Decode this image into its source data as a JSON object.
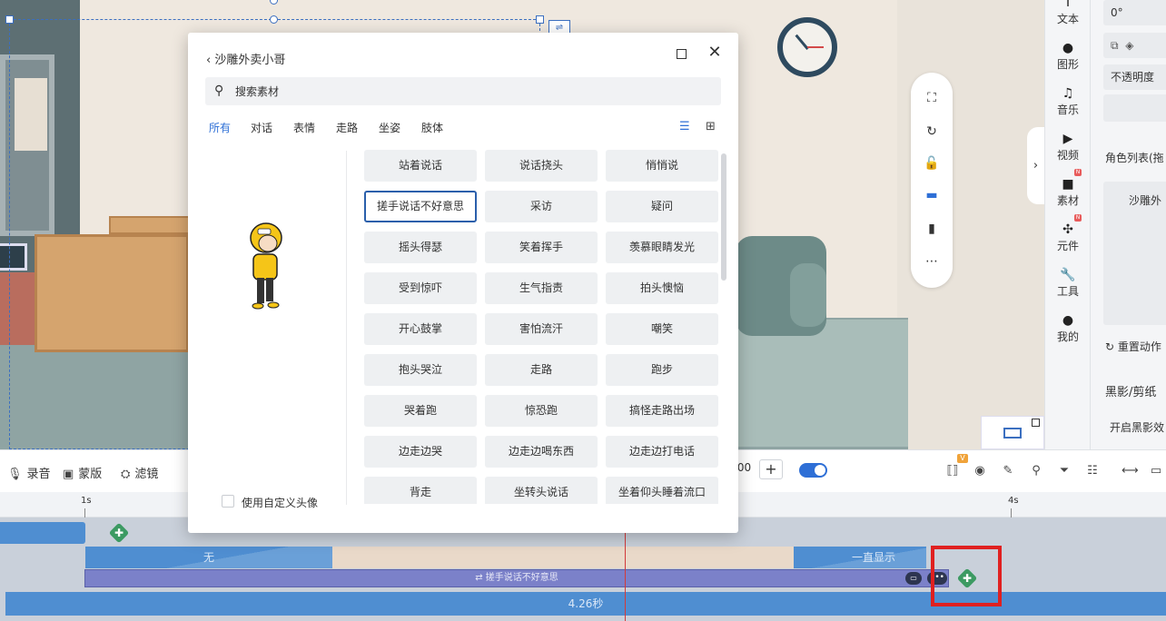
{
  "modal": {
    "title": "沙雕外卖小哥",
    "search_placeholder": "搜索素材",
    "tabs": [
      "所有",
      "对话",
      "表情",
      "走路",
      "坐姿",
      "肢体"
    ],
    "active_tab": "所有",
    "custom_avatar_label": "使用自定义头像",
    "actions": [
      "站着说话",
      "说话挠头",
      "悄悄说",
      "搓手说话不好意思",
      "采访",
      "疑问",
      "摇头得瑟",
      "笑着挥手",
      "羡慕眼睛发光",
      "受到惊吓",
      "生气指责",
      "拍头懊恼",
      "开心鼓掌",
      "害怕流汗",
      "嘲笑",
      "抱头哭泣",
      "走路",
      "跑步",
      "哭着跑",
      "惊恐跑",
      "搞怪走路出场",
      "边走边哭",
      "边走边喝东西",
      "边走边打电话",
      "背走",
      "坐转头说话",
      "坐着仰头睡着流口"
    ],
    "selected_action": "搓手说话不好意思"
  },
  "right_sidebar": {
    "items": [
      {
        "label": "文本",
        "icon": "text-icon"
      },
      {
        "label": "图形",
        "icon": "shape-icon"
      },
      {
        "label": "音乐",
        "icon": "music-icon"
      },
      {
        "label": "视频",
        "icon": "video-icon"
      },
      {
        "label": "素材",
        "icon": "folder-icon",
        "badge": "N"
      },
      {
        "label": "元件",
        "icon": "pinwheel-icon",
        "badge": "N"
      },
      {
        "label": "工具",
        "icon": "wrench-icon"
      },
      {
        "label": "我的",
        "icon": "user-icon"
      }
    ]
  },
  "props": {
    "rotation": "0°",
    "opacity_label": "不透明度",
    "role_list_label": "角色列表(拖",
    "role_item": "沙雕外",
    "reset_label": "重置动作",
    "silhouette_section": "黑影/剪纸",
    "silhouette_toggle": "开启黑影效"
  },
  "bottom_toolbar": {
    "record": "录音",
    "mask": "蒙版",
    "filter": "滤镜",
    "zoom_value": ".00",
    "zoom_plus": "+",
    "vip_badge": "V"
  },
  "timeline": {
    "ticks": [
      "1s",
      "4s"
    ],
    "track_none": "无",
    "track_always": "一直显示",
    "action_clip": "搓手说话不好意思",
    "duration": "4.26秒"
  }
}
